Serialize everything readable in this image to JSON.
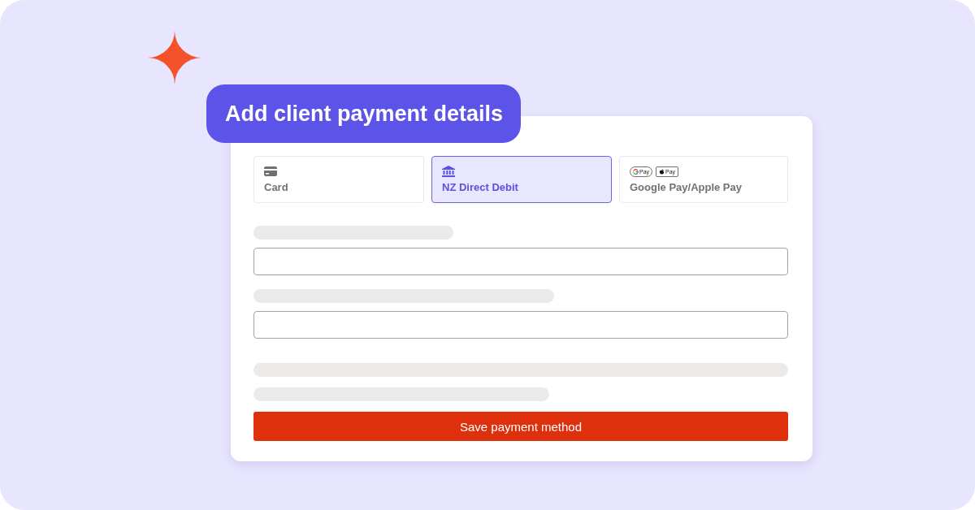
{
  "heading": "Add client payment details",
  "payment_methods": [
    {
      "kind": "card",
      "label": "Card",
      "selected": false
    },
    {
      "kind": "bank",
      "label": "NZ Direct Debit",
      "selected": true
    },
    {
      "kind": "wallets",
      "label": "Google Pay/Apple Pay",
      "selected": false,
      "badges": [
        {
          "kind": "google",
          "text": "Pay"
        },
        {
          "kind": "apple",
          "text": "Pay"
        }
      ]
    }
  ],
  "submit_button": "Save payment method"
}
